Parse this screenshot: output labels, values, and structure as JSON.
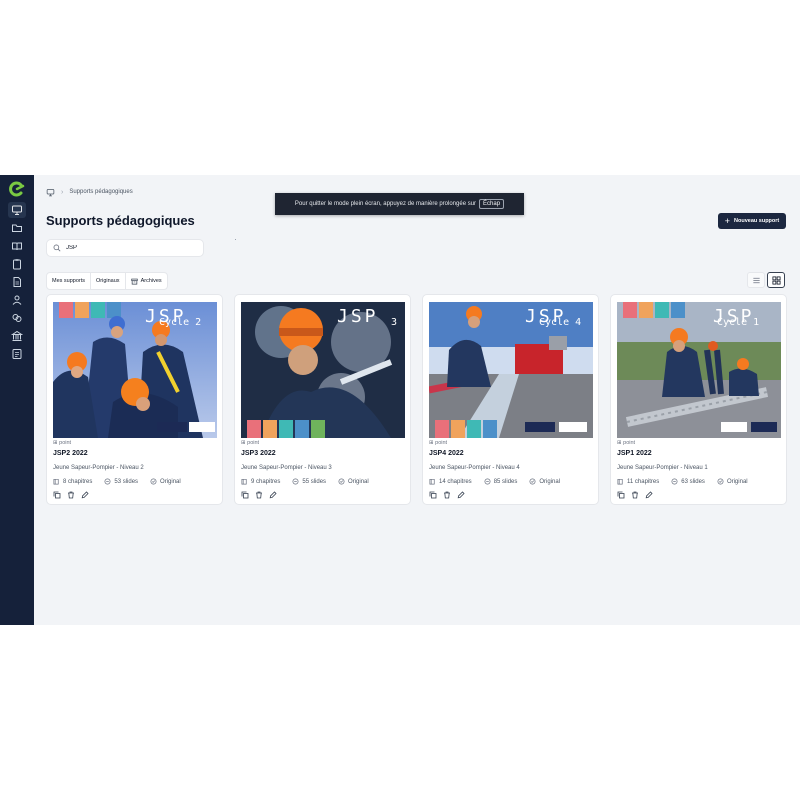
{
  "sidebar": {
    "items": [
      {
        "icon": "presentation-icon",
        "active": true
      },
      {
        "icon": "folder-icon"
      },
      {
        "icon": "book-open-icon"
      },
      {
        "icon": "clipboard-icon"
      },
      {
        "icon": "document-icon"
      },
      {
        "icon": "users-icon"
      },
      {
        "icon": "layers-icon"
      },
      {
        "icon": "building-icon"
      },
      {
        "icon": "id-card-icon"
      }
    ]
  },
  "breadcrumb": {
    "icon": "presentation-icon",
    "current": "Supports pédagogiques"
  },
  "toast": {
    "message": "Pour quitter le mode plein écran, appuyez de manière prolongée sur",
    "key": "Échap"
  },
  "page": {
    "title": "Supports pédagogiques"
  },
  "new_button": {
    "label": "Nouveau support"
  },
  "search": {
    "value": "JSP"
  },
  "filters": [
    {
      "label": "Mes supports"
    },
    {
      "label": "Originaux"
    },
    {
      "label": "Archives"
    }
  ],
  "colors": {
    "sidebar": "#15213a",
    "primary": "#1c2740",
    "background": "#f2f4f7"
  },
  "cards": [
    {
      "tag": "⊞ point",
      "title": "JSP2 2022",
      "subtitle": "Jeune Sapeur-Pompier - Niveau 2",
      "chapters": "8 chapitres",
      "slides": "53 slides",
      "status": "Original",
      "thumb": {
        "logo": "JSP",
        "cycle": "Cycle 2"
      }
    },
    {
      "tag": "⊞ point",
      "title": "JSP3 2022",
      "subtitle": "Jeune Sapeur-Pompier - Niveau 3",
      "chapters": "9 chapitres",
      "slides": "55 slides",
      "status": "Original",
      "thumb": {
        "logo": "JSP",
        "cycle": "3"
      }
    },
    {
      "tag": "⊞ point",
      "title": "JSP4 2022",
      "subtitle": "Jeune Sapeur-Pompier - Niveau 4",
      "chapters": "14 chapitres",
      "slides": "85 slides",
      "status": "Original",
      "thumb": {
        "logo": "JSP",
        "cycle": "Cycle 4"
      }
    },
    {
      "tag": "⊞ point",
      "title": "JSP1 2022",
      "subtitle": "Jeune Sapeur-Pompier - Niveau 1",
      "chapters": "11 chapitres",
      "slides": "63 slides",
      "status": "Original",
      "thumb": {
        "logo": "JSP",
        "cycle": "Cycle 1"
      }
    }
  ]
}
